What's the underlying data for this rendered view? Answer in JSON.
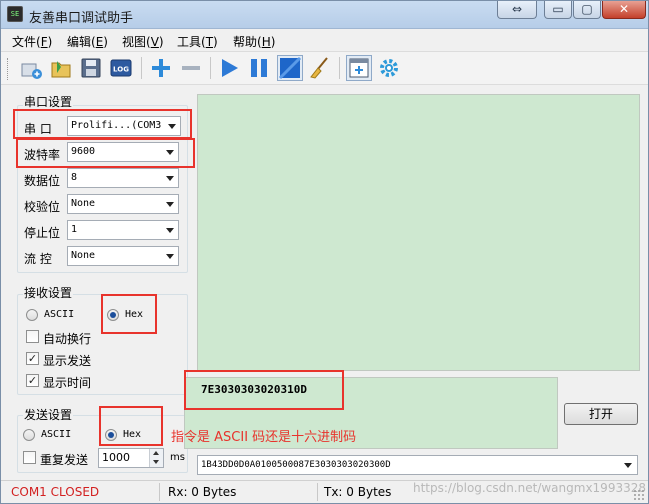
{
  "window": {
    "title": "友善串口调试助手",
    "app_icon_text": "SE",
    "restore_glyph": "⇔",
    "min_glyph": "▭",
    "max_glyph": "▢",
    "close_glyph": "✕"
  },
  "menu": [
    {
      "label": "文件(",
      "key": "F",
      "end": ")"
    },
    {
      "label": "编辑(",
      "key": "E",
      "end": ")"
    },
    {
      "label": "视图(",
      "key": "V",
      "end": ")"
    },
    {
      "label": "工具(",
      "key": "T",
      "end": ")"
    },
    {
      "label": "帮助(",
      "key": "H",
      "end": ")"
    }
  ],
  "toolbar": {
    "icons": [
      "new-connection-icon",
      "open-folder-icon",
      "save-icon",
      "log-icon",
      "add-icon",
      "remove-icon",
      "play-icon",
      "pause-icon",
      "window-icon",
      "clear-broom-icon",
      "new-window-icon",
      "settings-gear-icon"
    ],
    "log_label": "LOG"
  },
  "serial_settings": {
    "title": "串口设置",
    "port": {
      "label": "串  口",
      "value": "Prolifi...(COM3"
    },
    "baud": {
      "label": "波特率",
      "value": "9600"
    },
    "data_bits": {
      "label": "数据位",
      "value": "8"
    },
    "parity": {
      "label": "校验位",
      "value": "None"
    },
    "stop_bits": {
      "label": "停止位",
      "value": "1"
    },
    "flow": {
      "label": "流  控",
      "value": "None"
    }
  },
  "receive_settings": {
    "title": "接收设置",
    "ascii_label": "ASCII",
    "hex_label": "Hex",
    "selected": "Hex",
    "auto_wrap": {
      "label": "自动换行",
      "checked": false
    },
    "show_send": {
      "label": "显示发送",
      "checked": true
    },
    "show_time": {
      "label": "显示时间",
      "checked": true
    }
  },
  "send_settings": {
    "title": "发送设置",
    "ascii_label": "ASCII",
    "hex_label": "Hex",
    "selected": "Hex",
    "repeat": {
      "label": "重复发送",
      "checked": false
    },
    "interval_value": "1000",
    "interval_unit": "ms"
  },
  "send_text": "7E3030303020310D",
  "annotation": "指令是 ASCII 码还是十六进制码",
  "send_button_label": "打开",
  "history_value": "1B43DD0D0A0100500087E3030303020300D",
  "status": {
    "port_state": "COM1 CLOSED",
    "rx": "Rx: 0 Bytes",
    "tx": "Tx: 0 Bytes",
    "watermark": "https://blog.csdn.net/wangmx1993328"
  },
  "colors": {
    "accent_red": "#e8332c",
    "text_area_green": "#cee8d0",
    "status_red": "#d22020"
  }
}
